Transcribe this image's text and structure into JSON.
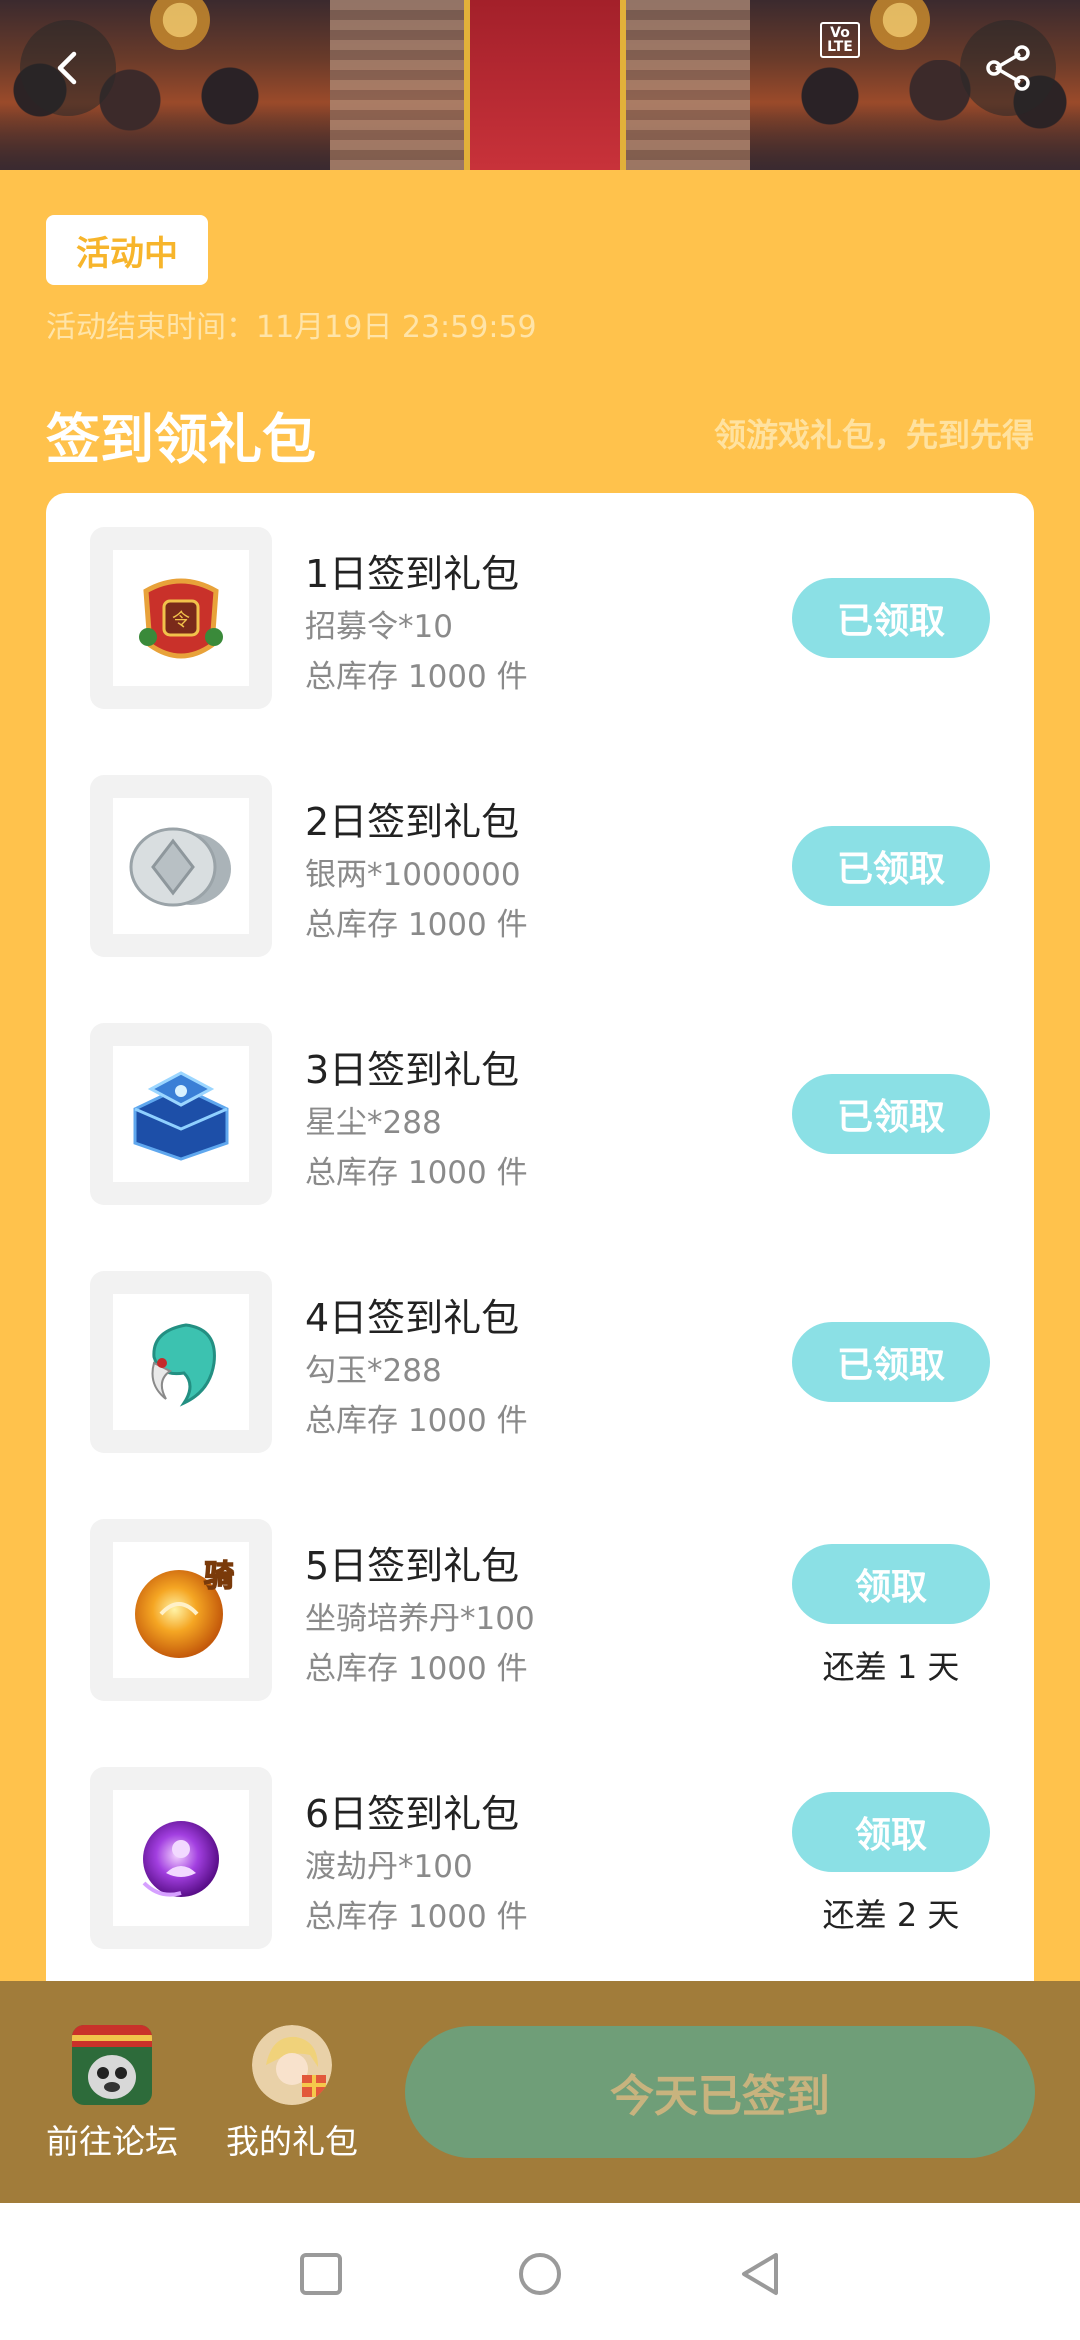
{
  "header": {
    "back_icon": "chevron-left-icon",
    "share_icon": "share-icon",
    "status_bar": {
      "volte": "Vo LTE"
    }
  },
  "status": {
    "badge": "活动中",
    "end_time_label": "活动结束时间：",
    "end_time_value": "11月19日 23:59:59"
  },
  "section": {
    "title": "签到领礼包",
    "subtitle": "领游戏礼包，先到先得"
  },
  "packs": [
    {
      "title": "1日签到礼包",
      "reward": "招募令*10",
      "stock": "总库存 1000 件",
      "button": "已领取",
      "icon": "recruit-token-icon",
      "days_left": ""
    },
    {
      "title": "2日签到礼包",
      "reward": "银两*1000000",
      "stock": "总库存 1000 件",
      "button": "已领取",
      "icon": "silver-coin-icon",
      "days_left": ""
    },
    {
      "title": "3日签到礼包",
      "reward": "星尘*288",
      "stock": "总库存 1000 件",
      "button": "已领取",
      "icon": "stardust-chest-icon",
      "days_left": ""
    },
    {
      "title": "4日签到礼包",
      "reward": "勾玉*288",
      "stock": "总库存 1000 件",
      "button": "已领取",
      "icon": "magatama-icon",
      "days_left": ""
    },
    {
      "title": "5日签到礼包",
      "reward": "坐骑培养丹*100",
      "stock": "总库存 1000 件",
      "button": "领取",
      "icon": "mount-pill-icon",
      "days_left": "还差 1 天",
      "icon_char": "骑"
    },
    {
      "title": "6日签到礼包",
      "reward": "渡劫丹*100",
      "stock": "总库存 1000 件",
      "button": "领取",
      "icon": "tribulation-pill-icon",
      "days_left": "还差 2 天"
    }
  ],
  "bottom_bar": {
    "forum_label": "前往论坛",
    "gifts_label": "我的礼包",
    "checked_in_label": "今天已签到"
  },
  "nav": {
    "recent_icon": "square-icon",
    "home_icon": "circle-icon",
    "back_icon": "triangle-back-icon"
  },
  "colors": {
    "background": "#ffc24c",
    "claim_button": "#8be0e5",
    "checked_in_button": "#6f9e78",
    "bottom_bar": "#a17c3a"
  }
}
